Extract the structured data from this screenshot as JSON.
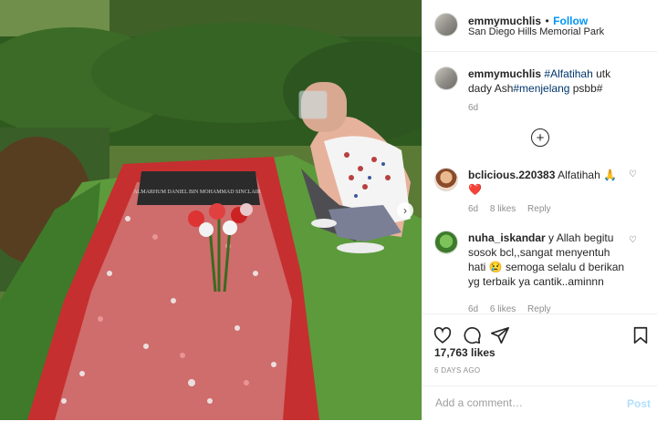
{
  "post": {
    "username": "emmymuchlis",
    "follow_label": "Follow",
    "location": "San Diego Hills Memorial Park",
    "caption": {
      "username": "emmymuchlis",
      "hashtag1": "#Alfatihah",
      "text1": " utk dady Ash",
      "hashtag2": "#menjelang",
      "text2": " psbb#",
      "age": "6d"
    },
    "headstone_text": "ALMARHUM DANIEL BIN MOHAMMAD SINCLAIR"
  },
  "comments": [
    {
      "username": "bclicious.220383",
      "text": "Alfatihah 🙏 ❤️",
      "age": "6d",
      "likes": "8 likes",
      "reply": "Reply"
    },
    {
      "username": "nuha_iskandar",
      "text": "y Allah begitu sosok bcl,,sangat menyentuh hati 😢 semoga selalu d berikan yg terbaik ya cantik..aminnn",
      "age": "6d",
      "likes": "6 likes",
      "reply": "Reply"
    }
  ],
  "stats": {
    "likes": "17,763 likes",
    "time_ago": "6 DAYS AGO"
  },
  "add_comment": {
    "placeholder": "Add a comment…",
    "post_label": "Post"
  },
  "icons": {
    "dot": "•",
    "more_comments": "plus-circle-icon",
    "like": "heart-icon",
    "comment": "comment-icon",
    "share": "paper-plane-icon",
    "save": "bookmark-icon",
    "next": "chevron-right-icon"
  },
  "colors": {
    "follow": "#0095f6",
    "hashtag": "#00376b",
    "muted": "#8e8e8e"
  }
}
